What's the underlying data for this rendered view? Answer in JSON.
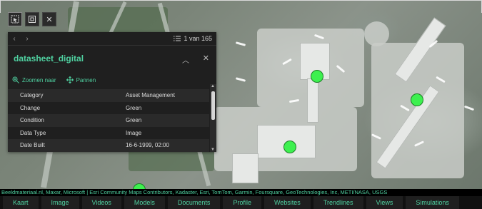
{
  "toolbar": {
    "buttons": [
      {
        "icon": "select-cursor-icon"
      },
      {
        "icon": "layer-icon"
      },
      {
        "icon": "close-icon",
        "glyph": "✕"
      }
    ]
  },
  "popup": {
    "nav": {
      "prev": "‹",
      "next": "›",
      "count_label": "1 van 165"
    },
    "title": "datasheet_digital",
    "actions": [
      {
        "icon": "zoom-icon",
        "label": "Zoomen naar"
      },
      {
        "icon": "pan-icon",
        "label": "Pannen"
      }
    ],
    "rows": [
      {
        "key": "Category",
        "value": "Asset Management"
      },
      {
        "key": "Change",
        "value": "Green"
      },
      {
        "key": "Condition",
        "value": "Green"
      },
      {
        "key": "Data Type",
        "value": "Image"
      },
      {
        "key": "Date Built",
        "value": "16-6-1999, 02:00"
      }
    ]
  },
  "attribution": "Beeldmateriaal.nl, Maxar, Microsoft | Esri Community Maps Contributors, Kadaster, Esri, TomTom, Garmin, Foursquare, GeoTechnologies, Inc, METI/NASA, USGS",
  "tabs": [
    "Kaart",
    "Image",
    "Videos",
    "Models",
    "Documents",
    "Profile",
    "Websites",
    "Trendlines",
    "Views",
    "Simulations"
  ],
  "colors": {
    "accent": "#4fd0a0",
    "marker": "#3df04f",
    "panel_bg": "#1f1f1f"
  }
}
